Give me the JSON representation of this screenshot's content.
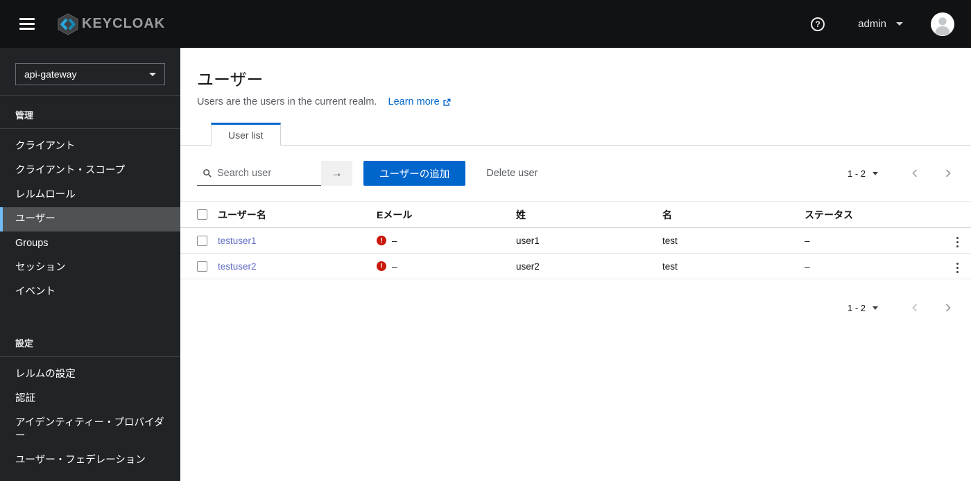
{
  "topbar": {
    "brand": "KEYCLOAK",
    "help": "?",
    "username": "admin"
  },
  "sidebar": {
    "realm": "api-gateway",
    "sections": [
      {
        "title": "管理",
        "items": [
          {
            "label": "クライアント"
          },
          {
            "label": "クライアント・スコープ"
          },
          {
            "label": "レルムロール"
          },
          {
            "label": "ユーザー",
            "active": true
          },
          {
            "label": "Groups"
          },
          {
            "label": "セッション"
          },
          {
            "label": "イベント"
          }
        ]
      },
      {
        "title": "設定",
        "items": [
          {
            "label": "レルムの設定"
          },
          {
            "label": "認証"
          },
          {
            "label": "アイデンティティー・プロバイダー"
          },
          {
            "label": "ユーザー・フェデレーション"
          }
        ]
      }
    ]
  },
  "page": {
    "title": "ユーザー",
    "description": "Users are the users in the current realm.",
    "learn_more": "Learn more",
    "tab": "User list"
  },
  "toolbar": {
    "search_placeholder": "Search user",
    "search_go": "→",
    "add_user_label": "ユーザーの追加",
    "delete_user_label": "Delete user"
  },
  "pagination": {
    "range": "1 - 2"
  },
  "table": {
    "headers": [
      "ユーザー名",
      "Eメール",
      "姓",
      "名",
      "ステータス"
    ],
    "rows": [
      {
        "username": "testuser1",
        "email": "–",
        "last_name": "user1",
        "first_name": "test",
        "status": "–"
      },
      {
        "username": "testuser2",
        "email": "–",
        "last_name": "user2",
        "first_name": "test",
        "status": "–"
      }
    ]
  },
  "colors": {
    "accent": "#0066cc",
    "danger": "#c9190b",
    "link": "#636ec6",
    "nav_current_border": "#73bcf7"
  }
}
